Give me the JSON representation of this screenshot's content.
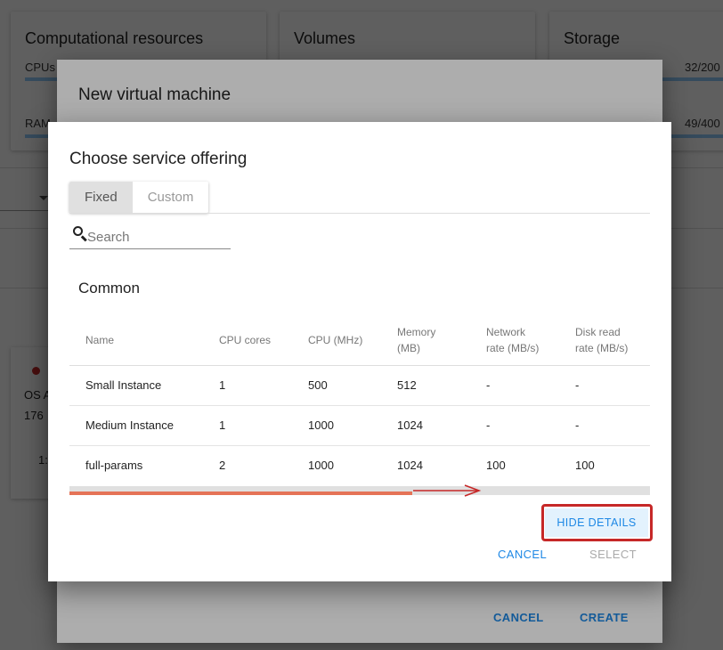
{
  "background": {
    "cards": [
      {
        "title": "Computational resources",
        "rows": [
          {
            "label": "CPUs",
            "value": ""
          },
          {
            "label": "RAM",
            "value": ""
          }
        ]
      },
      {
        "title": "Volumes"
      },
      {
        "title": "Storage",
        "rows": [
          {
            "label": "",
            "value": "32/200"
          },
          {
            "label": "",
            "value": "49/400"
          }
        ]
      }
    ],
    "vm_card": {
      "line1": "OS A",
      "line2": "176",
      "line3": "1:"
    }
  },
  "outer_dialog": {
    "title": "New virtual machine",
    "cancel_label": "CANCEL",
    "create_label": "CREATE"
  },
  "inner_dialog": {
    "title": "Choose service offering",
    "tabs": [
      {
        "label": "Fixed",
        "active": true
      },
      {
        "label": "Custom",
        "active": false
      }
    ],
    "search": {
      "placeholder": "Search",
      "value": ""
    },
    "group_title": "Common",
    "table": {
      "headers": [
        {
          "line1": "Name",
          "line2": ""
        },
        {
          "line1": "CPU cores",
          "line2": ""
        },
        {
          "line1": "CPU (MHz)",
          "line2": ""
        },
        {
          "line1": "Memory",
          "line2": "(MB)"
        },
        {
          "line1": "Network",
          "line2": "rate (MB/s)"
        },
        {
          "line1": "Disk read",
          "line2": "rate (MB/s)"
        }
      ],
      "rows": [
        [
          "Small Instance",
          "1",
          "500",
          "512",
          "-",
          "-"
        ],
        [
          "Medium Instance",
          "1",
          "1000",
          "1024",
          "-",
          "-"
        ],
        [
          "full-params",
          "2",
          "1000",
          "1024",
          "100",
          "100"
        ]
      ]
    },
    "hide_details_label": "HIDE DETAILS",
    "cancel_label": "CANCEL",
    "select_label": "SELECT"
  },
  "colors": {
    "accent": "#1e88e5",
    "highlight": "#c62828",
    "scroll_thumb": "#e57357",
    "status_dot": "#c62828"
  }
}
